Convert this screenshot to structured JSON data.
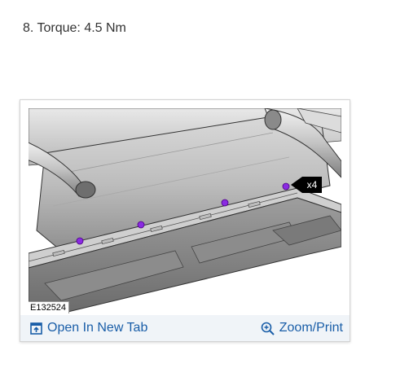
{
  "step": {
    "text": "8. Torque: 4.5 Nm"
  },
  "figure": {
    "id_label": "E132524",
    "callout_label": "x4"
  },
  "actions": {
    "open_tab_label": "Open In New Tab",
    "zoom_print_label": "Zoom/Print",
    "open_tab_icon": "open-new-tab-icon",
    "zoom_icon": "magnifier-plus-icon"
  },
  "colors": {
    "link": "#1a5ea8",
    "fastener": "#8a2be2",
    "action_bar_bg": "#f0f4f8"
  }
}
